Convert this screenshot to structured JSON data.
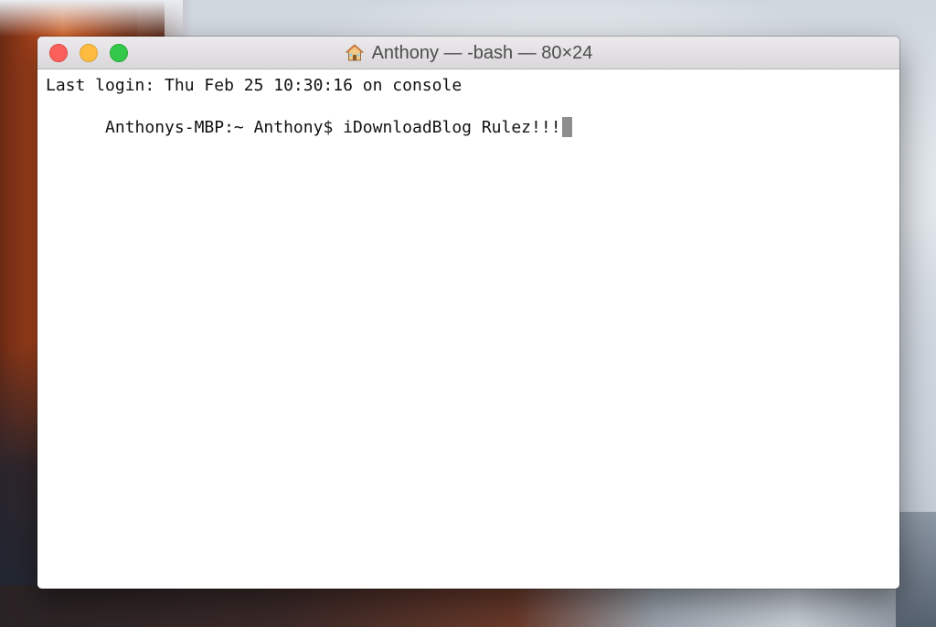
{
  "desktop": {
    "wallpaper": "macOS El Capitan landscape"
  },
  "window": {
    "title": "Anthony — -bash — 80×24",
    "title_icon": "home-icon",
    "buttons": {
      "close": {
        "color": "#fc605c"
      },
      "minimize": {
        "color": "#fdbc40"
      },
      "zoom": {
        "color": "#34c84a"
      }
    }
  },
  "terminal": {
    "lines": [
      "Last login: Thu Feb 25 10:30:16 on console",
      "Anthonys-MBP:~ Anthony$ iDownloadBlog Rulez!!!"
    ],
    "cursor_color": "#8e8e8e"
  }
}
